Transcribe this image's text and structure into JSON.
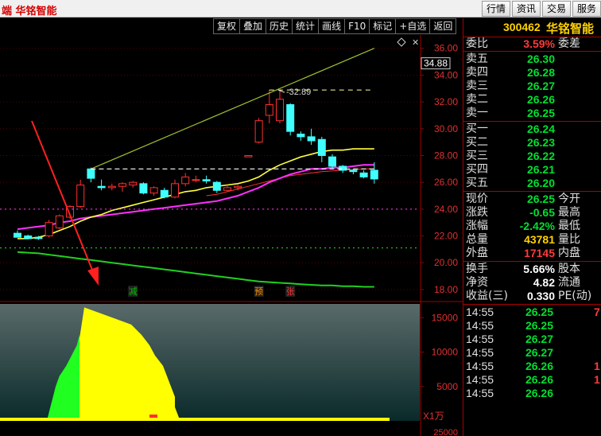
{
  "window": {
    "title": "端 华铭智能",
    "top_buttons": [
      "行情",
      "资讯",
      "交易",
      "服务"
    ]
  },
  "toolbar": {
    "buttons": [
      "复权",
      "叠加",
      "历史",
      "统计",
      "画线",
      "F10",
      "标记",
      "+自选",
      "返回"
    ]
  },
  "chart": {
    "y_labels": [
      "36.00",
      "34.00",
      "32.00",
      "30.00",
      "28.00",
      "26.00",
      "24.00",
      "22.00",
      "20.00",
      "18.00"
    ],
    "current_price_tag": "34.88",
    "high_annotation": "32.89",
    "markers": [
      {
        "text": "减",
        "color": "#00c000",
        "day": 11
      },
      {
        "text": "预",
        "color": "#ff9000",
        "day": 23
      },
      {
        "text": "张",
        "color": "#ff3030",
        "day": 26
      }
    ],
    "volume_axis": [
      "15000",
      "10000",
      "5000"
    ],
    "volume_unit": "X1万",
    "volume_bottom_label": "25000"
  },
  "chart_data": {
    "type": "candlestick",
    "ylim": [
      17.4,
      36.4
    ],
    "candles": [
      {
        "o": 22.2,
        "h": 22.4,
        "l": 21.9,
        "c": 21.9
      },
      {
        "o": 22.0,
        "h": 22.1,
        "l": 21.8,
        "c": 21.8
      },
      {
        "o": 21.9,
        "h": 22.0,
        "l": 21.7,
        "c": 21.8
      },
      {
        "o": 22.0,
        "h": 23.2,
        "l": 21.9,
        "c": 23.0
      },
      {
        "o": 22.6,
        "h": 23.6,
        "l": 22.5,
        "c": 23.5
      },
      {
        "o": 23.4,
        "h": 24.3,
        "l": 23.3,
        "c": 24.2
      },
      {
        "o": 24.2,
        "h": 26.2,
        "l": 24.1,
        "c": 25.8
      },
      {
        "o": 27.0,
        "h": 27.1,
        "l": 26.0,
        "c": 26.3
      },
      {
        "o": 25.7,
        "h": 26.2,
        "l": 25.4,
        "c": 25.6
      },
      {
        "o": 25.6,
        "h": 25.9,
        "l": 25.4,
        "c": 25.7
      },
      {
        "o": 25.7,
        "h": 26.0,
        "l": 25.3,
        "c": 25.9
      },
      {
        "o": 25.8,
        "h": 26.1,
        "l": 25.6,
        "c": 26.0
      },
      {
        "o": 25.9,
        "h": 26.0,
        "l": 25.1,
        "c": 25.2
      },
      {
        "o": 25.2,
        "h": 25.7,
        "l": 25.0,
        "c": 25.6
      },
      {
        "o": 25.4,
        "h": 25.6,
        "l": 24.8,
        "c": 24.9
      },
      {
        "o": 24.9,
        "h": 26.2,
        "l": 24.8,
        "c": 25.9
      },
      {
        "o": 25.9,
        "h": 26.7,
        "l": 25.7,
        "c": 26.4
      },
      {
        "o": 26.2,
        "h": 26.5,
        "l": 26.0,
        "c": 26.2
      },
      {
        "o": 26.2,
        "h": 26.5,
        "l": 25.9,
        "c": 26.1
      },
      {
        "o": 26.0,
        "h": 26.1,
        "l": 25.2,
        "c": 25.4
      },
      {
        "o": 25.4,
        "h": 25.8,
        "l": 25.3,
        "c": 25.6
      },
      {
        "o": 25.6,
        "h": 25.8,
        "l": 25.4,
        "c": 25.7
      },
      {
        "o": 27.9,
        "h": 28.0,
        "l": 27.9,
        "c": 28.0
      },
      {
        "o": 29.0,
        "h": 30.8,
        "l": 28.9,
        "c": 30.6
      },
      {
        "o": 31.0,
        "h": 32.9,
        "l": 30.4,
        "c": 31.8
      },
      {
        "o": 30.6,
        "h": 32.9,
        "l": 30.4,
        "c": 32.2
      },
      {
        "o": 31.8,
        "h": 31.9,
        "l": 29.5,
        "c": 29.8
      },
      {
        "o": 29.6,
        "h": 29.8,
        "l": 29.1,
        "c": 29.4
      },
      {
        "o": 29.4,
        "h": 30.0,
        "l": 28.8,
        "c": 29.1
      },
      {
        "o": 29.2,
        "h": 29.4,
        "l": 27.5,
        "c": 28.0
      },
      {
        "o": 27.9,
        "h": 28.1,
        "l": 27.0,
        "c": 27.2
      },
      {
        "o": 27.2,
        "h": 27.3,
        "l": 26.7,
        "c": 26.9
      },
      {
        "o": 26.9,
        "h": 27.0,
        "l": 26.6,
        "c": 26.8
      },
      {
        "o": 26.7,
        "h": 26.9,
        "l": 26.3,
        "c": 26.4
      },
      {
        "o": 26.9,
        "h": 27.5,
        "l": 25.9,
        "c": 26.25
      }
    ],
    "ma_yellow": [
      21.8,
      21.8,
      21.9,
      22.1,
      22.4,
      22.7,
      23.1,
      23.4,
      23.6,
      23.9,
      24.1,
      24.3,
      24.5,
      24.7,
      24.9,
      25.1,
      25.3,
      25.4,
      25.6,
      25.7,
      25.8,
      25.9,
      26.1,
      26.4,
      26.9,
      27.3,
      27.6,
      27.9,
      28.1,
      28.3,
      28.4,
      28.4,
      28.5,
      28.5,
      28.5
    ],
    "ma_magenta": [
      22.5,
      22.6,
      22.7,
      22.8,
      23.0,
      23.1,
      23.3,
      23.4,
      23.5,
      23.6,
      23.7,
      23.8,
      23.9,
      24.0,
      24.1,
      24.2,
      24.3,
      24.4,
      24.5,
      24.6,
      24.8,
      25.0,
      25.3,
      25.6,
      26.0,
      26.3,
      26.6,
      26.8,
      27.0,
      27.0,
      27.1,
      27.1,
      27.2,
      27.3,
      27.3
    ],
    "ma_red": [
      null,
      null,
      null,
      null,
      null,
      null,
      null,
      null,
      null,
      null,
      null,
      null,
      null,
      null,
      null,
      null,
      null,
      null,
      25.0,
      25.1,
      25.3,
      25.5,
      25.7,
      25.9,
      26.1,
      26.3,
      26.5,
      26.6,
      26.7,
      26.8,
      26.85,
      26.9,
      26.95,
      27.0,
      27.0
    ],
    "ma_green": [
      20.8,
      20.75,
      20.7,
      20.6,
      20.5,
      20.4,
      20.3,
      20.2,
      20.1,
      20.0,
      19.9,
      19.8,
      19.7,
      19.6,
      19.5,
      19.4,
      19.3,
      19.2,
      19.1,
      19.0,
      18.9,
      18.8,
      18.7,
      18.6,
      18.55,
      18.5,
      18.45,
      18.4,
      18.35,
      18.3,
      18.3,
      18.25,
      18.25,
      18.2,
      18.2
    ],
    "trendline": {
      "from": [
        7,
        27.0
      ],
      "to": [
        34,
        36.0
      ]
    },
    "resistance_dash": {
      "from_day": 7,
      "to_day": 34,
      "price": 27.0
    },
    "high_dash": {
      "from_day": 24,
      "to_day": 34,
      "price": 32.89
    },
    "support_dash_magenta": 24.0,
    "support_dash_green": 21.1,
    "volume_profile": [
      {
        "y": 15000,
        "yellow": 0,
        "green": 0
      },
      {
        "y": 14000,
        "yellow": 6500,
        "green": 0
      },
      {
        "y": 12500,
        "yellow": 7800,
        "green": 0
      },
      {
        "y": 11000,
        "yellow": 8800,
        "green": 500
      },
      {
        "y": 9500,
        "yellow": 9500,
        "green": 1500
      },
      {
        "y": 8000,
        "yellow": 10500,
        "green": 2500
      },
      {
        "y": 6500,
        "yellow": 11000,
        "green": 3800
      },
      {
        "y": 5000,
        "yellow": 11500,
        "green": 4500
      },
      {
        "y": 3500,
        "yellow": 12000,
        "green": 5000
      },
      {
        "y": 2000,
        "yellow": 12000,
        "green": 5500
      },
      {
        "y": 500,
        "yellow": 12500,
        "green": 6000
      }
    ]
  },
  "panel": {
    "code": "300462",
    "name": "华铭智能",
    "weibi_label": "委比",
    "weibi_value": "3.59%",
    "weicha_label": "委差",
    "asks": [
      {
        "label": "卖五",
        "price": "26.30"
      },
      {
        "label": "卖四",
        "price": "26.28"
      },
      {
        "label": "卖三",
        "price": "26.27"
      },
      {
        "label": "卖二",
        "price": "26.26"
      },
      {
        "label": "卖一",
        "price": "26.25"
      }
    ],
    "bids": [
      {
        "label": "买一",
        "price": "26.24"
      },
      {
        "label": "买二",
        "price": "26.23"
      },
      {
        "label": "买三",
        "price": "26.22"
      },
      {
        "label": "买四",
        "price": "26.21"
      },
      {
        "label": "买五",
        "price": "26.20"
      }
    ],
    "stats": [
      {
        "label": "现价",
        "value": "26.25",
        "color": "green",
        "label2": "今开"
      },
      {
        "label": "涨跌",
        "value": "-0.65",
        "color": "green",
        "label2": "最高"
      },
      {
        "label": "涨幅",
        "value": "-2.42%",
        "color": "green",
        "label2": "最低"
      },
      {
        "label": "总量",
        "value": "43781",
        "color": "yellow",
        "label2": "量比"
      },
      {
        "label": "外盘",
        "value": "17145",
        "color": "red",
        "label2": "内盘"
      }
    ],
    "stats2": [
      {
        "label": "换手",
        "value": "5.66%",
        "color": "white",
        "label2": "股本"
      },
      {
        "label": "净资",
        "value": "4.82",
        "color": "white",
        "label2": "流通"
      },
      {
        "label": "收益(三)",
        "value": "0.330",
        "color": "white",
        "label2": "PE(动)"
      }
    ],
    "ticks": [
      {
        "time": "14:55",
        "price": "26.25",
        "vol": "7",
        "color": "red"
      },
      {
        "time": "14:55",
        "price": "26.25",
        "vol": "",
        "color": "red"
      },
      {
        "time": "14:55",
        "price": "26.27",
        "vol": "",
        "color": "red"
      },
      {
        "time": "14:55",
        "price": "26.27",
        "vol": "",
        "color": "red"
      },
      {
        "time": "14:55",
        "price": "26.26",
        "vol": "1",
        "color": "red"
      },
      {
        "time": "14:55",
        "price": "26.26",
        "vol": "1",
        "color": "red"
      },
      {
        "time": "14:55",
        "price": "26.26",
        "vol": "",
        "color": "red"
      }
    ]
  }
}
